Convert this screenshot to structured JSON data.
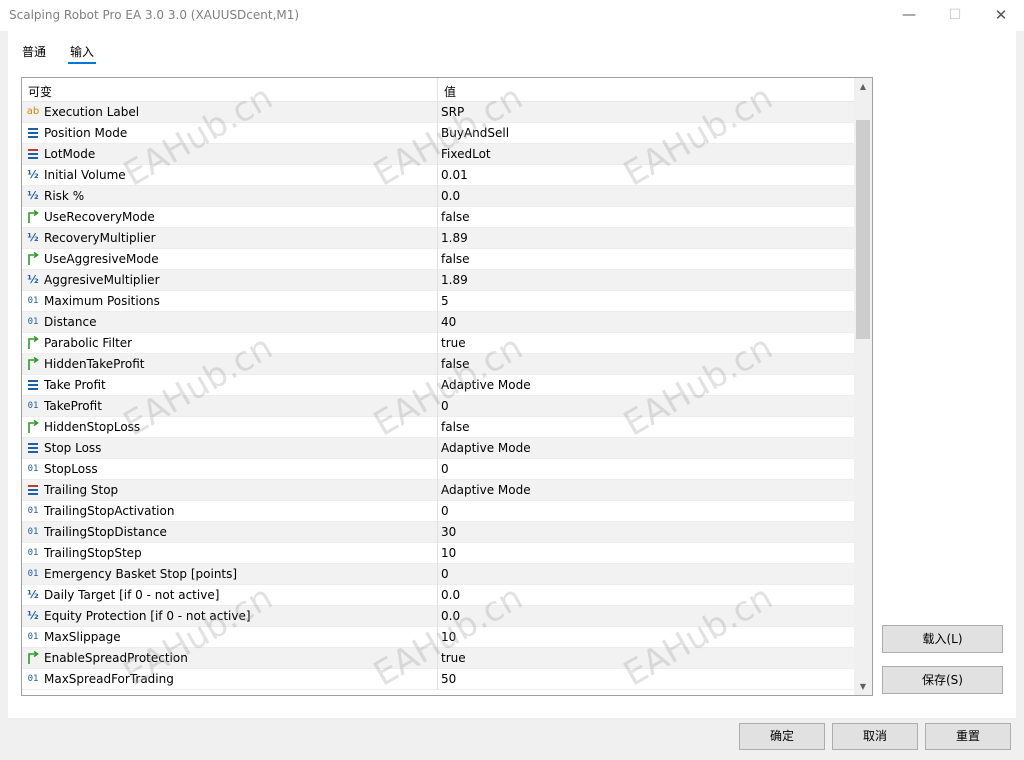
{
  "window": {
    "title": "Scalping Robot Pro EA 3.0 3.0 (XAUUSDcent,M1)",
    "minimize_glyph": "—",
    "maximize_glyph": "☐",
    "close_glyph": "✕"
  },
  "tabs": [
    {
      "label": "普通",
      "active": false
    },
    {
      "label": "输入",
      "active": true
    }
  ],
  "grid": {
    "columns": [
      "可变",
      "值"
    ],
    "rows": [
      {
        "icon": "ab",
        "name": "Execution Label",
        "value": "SRP"
      },
      {
        "icon": "enum",
        "name": "Position Mode",
        "value": "BuyAndSell"
      },
      {
        "icon": "enum-red",
        "name": "LotMode",
        "value": "FixedLot"
      },
      {
        "icon": "half",
        "name": "Initial Volume",
        "value": "0.01"
      },
      {
        "icon": "half",
        "name": "Risk %",
        "value": "0.0"
      },
      {
        "icon": "bool",
        "name": "UseRecoveryMode",
        "value": "false"
      },
      {
        "icon": "half",
        "name": "RecoveryMultiplier",
        "value": "1.89"
      },
      {
        "icon": "bool",
        "name": "UseAggresiveMode",
        "value": "false"
      },
      {
        "icon": "half",
        "name": "AggresiveMultiplier",
        "value": "1.89"
      },
      {
        "icon": "num",
        "name": "Maximum Positions",
        "value": "5"
      },
      {
        "icon": "num",
        "name": "Distance",
        "value": "40"
      },
      {
        "icon": "bool",
        "name": "Parabolic Filter",
        "value": "true"
      },
      {
        "icon": "bool",
        "name": "HiddenTakeProfit",
        "value": "false"
      },
      {
        "icon": "enum",
        "name": "Take Profit",
        "value": "Adaptive Mode"
      },
      {
        "icon": "num",
        "name": "TakeProfit",
        "value": "0"
      },
      {
        "icon": "bool",
        "name": "HiddenStopLoss",
        "value": "false"
      },
      {
        "icon": "enum",
        "name": "Stop Loss",
        "value": "Adaptive Mode"
      },
      {
        "icon": "num",
        "name": "StopLoss",
        "value": "0"
      },
      {
        "icon": "enum-red",
        "name": "Trailing Stop",
        "value": "Adaptive Mode"
      },
      {
        "icon": "num",
        "name": "TrailingStopActivation",
        "value": "0"
      },
      {
        "icon": "num",
        "name": "TrailingStopDistance",
        "value": "30"
      },
      {
        "icon": "num",
        "name": "TrailingStopStep",
        "value": "10"
      },
      {
        "icon": "num",
        "name": "Emergency Basket Stop [points]",
        "value": "0"
      },
      {
        "icon": "half",
        "name": "Daily Target [if 0 - not active]",
        "value": "0.0"
      },
      {
        "icon": "half",
        "name": "Equity Protection [if 0 - not active]",
        "value": "0.0"
      },
      {
        "icon": "num",
        "name": "MaxSlippage",
        "value": "10"
      },
      {
        "icon": "bool",
        "name": "EnableSpreadProtection",
        "value": "true"
      },
      {
        "icon": "num",
        "name": "MaxSpreadForTrading",
        "value": "50"
      }
    ]
  },
  "watermark": "EAHub.cn",
  "buttons": {
    "load": "载入(L)",
    "save": "保存(S)",
    "ok": "确定",
    "cancel": "取消",
    "reset": "重置"
  },
  "colors": {
    "accent": "#0078d7",
    "icon_blue": "#1e5fa8",
    "icon_green": "#2e9a2e",
    "icon_red": "#c0392b",
    "icon_orange": "#d08a00"
  }
}
